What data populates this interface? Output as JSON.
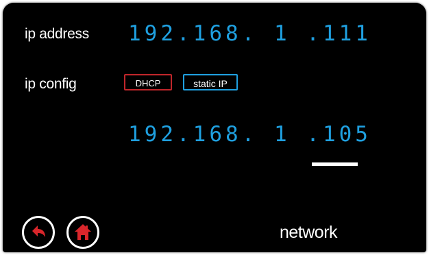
{
  "screen": {
    "title": "network",
    "ip_address": {
      "label": "ip address",
      "value": "192.168. 1 .111"
    },
    "ip_config": {
      "label": "ip config",
      "options": [
        {
          "label": "DHCP",
          "border_color": "#c0262b"
        },
        {
          "label": "static IP",
          "border_color": "#1fa0e0",
          "selected": true
        }
      ]
    },
    "static_ip_entry": {
      "value": "192.168. 1 .105",
      "active_field": "last-octet"
    }
  },
  "nav": {
    "back_icon": "back-arrow-icon",
    "home_icon": "home-icon"
  },
  "colors": {
    "background": "#000000",
    "accent_blue": "#1fa0e0",
    "accent_red": "#c0262b",
    "text": "#ffffff"
  }
}
